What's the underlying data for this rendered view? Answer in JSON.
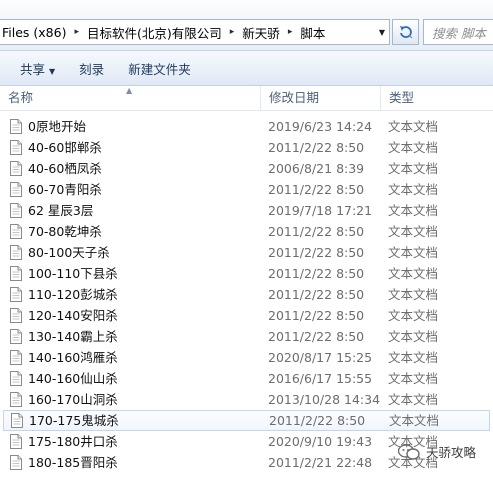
{
  "address": {
    "crumbs": [
      "Files (x86)",
      "目标软件(北京)有限公司",
      "新天骄",
      "脚本"
    ],
    "separator": "▸",
    "dropdown_icon": "chevron-down-icon"
  },
  "refresh_icon": "refresh-icon",
  "search": {
    "placeholder": "搜索 脚本"
  },
  "toolbar": {
    "share_label": "共享",
    "share_caret": "▼",
    "burn_label": "刻录",
    "new_folder_label": "新建文件夹"
  },
  "columns": {
    "name": "名称",
    "date": "修改日期",
    "type": "类型"
  },
  "files": [
    {
      "name": "0原地开始",
      "date": "2019/6/23 14:24",
      "type": "文本文档"
    },
    {
      "name": "40-60邯郸杀",
      "date": "2011/2/22 8:50",
      "type": "文本文档"
    },
    {
      "name": "40-60栖凤杀",
      "date": "2006/8/21 8:39",
      "type": "文本文档"
    },
    {
      "name": "60-70青阳杀",
      "date": "2011/2/22 8:50",
      "type": "文本文档"
    },
    {
      "name": "62 星辰3层",
      "date": "2019/7/18 17:21",
      "type": "文本文档"
    },
    {
      "name": "70-80乾坤杀",
      "date": "2011/2/22 8:50",
      "type": "文本文档"
    },
    {
      "name": "80-100天子杀",
      "date": "2011/2/22 8:50",
      "type": "文本文档"
    },
    {
      "name": "100-110下县杀",
      "date": "2011/2/22 8:50",
      "type": "文本文档"
    },
    {
      "name": "110-120彭城杀",
      "date": "2011/2/22 8:50",
      "type": "文本文档"
    },
    {
      "name": "120-140安阳杀",
      "date": "2011/2/22 8:50",
      "type": "文本文档"
    },
    {
      "name": "130-140霸上杀",
      "date": "2011/2/22 8:50",
      "type": "文本文档"
    },
    {
      "name": "140-160鸿雁杀",
      "date": "2020/8/17 15:25",
      "type": "文本文档"
    },
    {
      "name": "140-160仙山杀",
      "date": "2016/6/17 15:55",
      "type": "文本文档"
    },
    {
      "name": "160-170山洞杀",
      "date": "2013/10/28 14:34",
      "type": "文本文档"
    },
    {
      "name": "170-175鬼城杀",
      "date": "2011/2/22 8:50",
      "type": "文本文档",
      "selected": true
    },
    {
      "name": "175-180井口杀",
      "date": "2020/9/10 19:43",
      "type": "文本文档"
    },
    {
      "name": "180-185晋阳杀",
      "date": "2011/2/21 22:48",
      "type": "文本文档"
    }
  ],
  "watermark": {
    "text": "天骄攻略",
    "icon": "wechat-icon"
  }
}
